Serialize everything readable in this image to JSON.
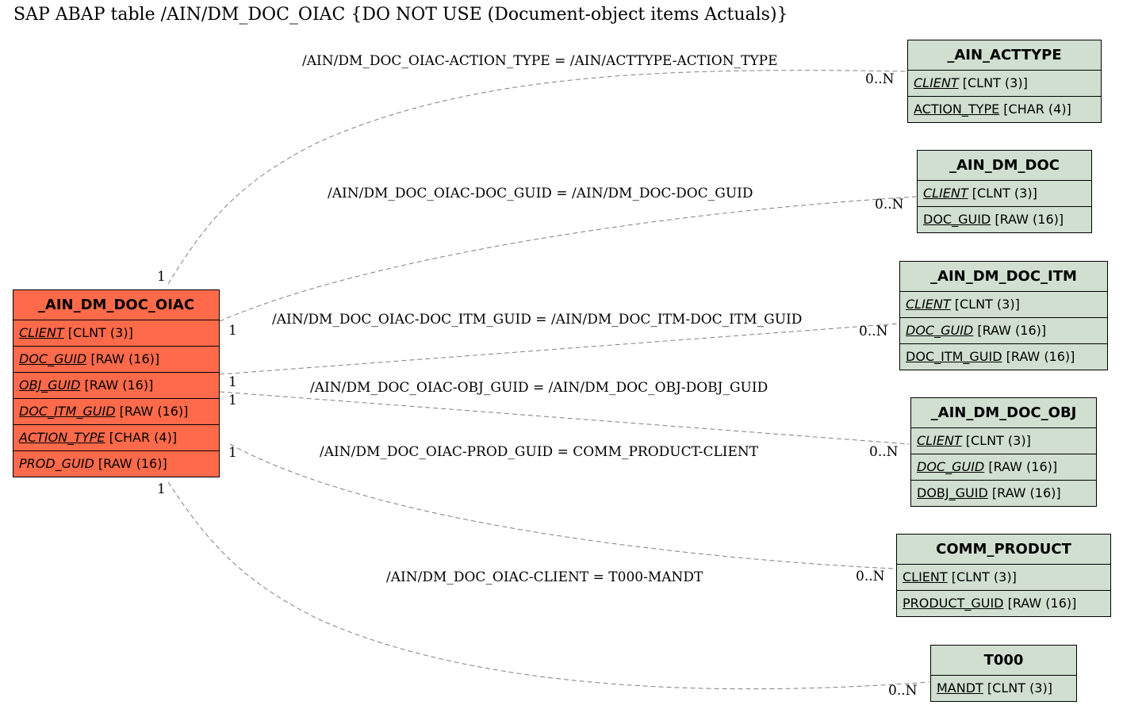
{
  "title": "SAP ABAP table /AIN/DM_DOC_OIAC {DO NOT USE (Document-object items Actuals)}",
  "main_table": {
    "name": "_AIN_DM_DOC_OIAC",
    "color": "#ff6a4a",
    "fields": [
      {
        "name": "CLIENT",
        "type": "[CLNT (3)]",
        "key": true
      },
      {
        "name": "DOC_GUID",
        "type": "[RAW (16)]",
        "key": true
      },
      {
        "name": "OBJ_GUID",
        "type": "[RAW (16)]",
        "key": true
      },
      {
        "name": "DOC_ITM_GUID",
        "type": "[RAW (16)]",
        "key": true
      },
      {
        "name": "ACTION_TYPE",
        "type": "[CHAR (4)]",
        "key": true
      },
      {
        "name": "PROD_GUID",
        "type": "[RAW (16)]",
        "key": false
      }
    ]
  },
  "ref_tables": [
    {
      "name": "_AIN_ACTTYPE",
      "fields": [
        {
          "name": "CLIENT",
          "type": "[CLNT (3)]",
          "italic": true
        },
        {
          "name": "ACTION_TYPE",
          "type": "[CHAR (4)]",
          "italic": false
        }
      ]
    },
    {
      "name": "_AIN_DM_DOC",
      "fields": [
        {
          "name": "CLIENT",
          "type": "[CLNT (3)]",
          "italic": true
        },
        {
          "name": "DOC_GUID",
          "type": "[RAW (16)]",
          "italic": false
        }
      ]
    },
    {
      "name": "_AIN_DM_DOC_ITM",
      "fields": [
        {
          "name": "CLIENT",
          "type": "[CLNT (3)]",
          "italic": true
        },
        {
          "name": "DOC_GUID",
          "type": "[RAW (16)]",
          "italic": true
        },
        {
          "name": "DOC_ITM_GUID",
          "type": "[RAW (16)]",
          "italic": false
        }
      ]
    },
    {
      "name": "_AIN_DM_DOC_OBJ",
      "fields": [
        {
          "name": "CLIENT",
          "type": "[CLNT (3)]",
          "italic": true
        },
        {
          "name": "DOC_GUID",
          "type": "[RAW (16)]",
          "italic": true
        },
        {
          "name": "DOBJ_GUID",
          "type": "[RAW (16)]",
          "italic": false
        }
      ]
    },
    {
      "name": "COMM_PRODUCT",
      "fields": [
        {
          "name": "CLIENT",
          "type": "[CLNT (3)]",
          "italic": false
        },
        {
          "name": "PRODUCT_GUID",
          "type": "[RAW (16)]",
          "italic": false
        }
      ]
    },
    {
      "name": "T000",
      "fields": [
        {
          "name": "MANDT",
          "type": "[CLNT (3)]",
          "italic": false
        }
      ]
    }
  ],
  "ref_color": "#d0dfd0",
  "relations": [
    {
      "label": "/AIN/DM_DOC_OIAC-ACTION_TYPE = /AIN/ACTTYPE-ACTION_TYPE",
      "from_card": "1",
      "to_card": "0..N"
    },
    {
      "label": "/AIN/DM_DOC_OIAC-DOC_GUID = /AIN/DM_DOC-DOC_GUID",
      "from_card": "1",
      "to_card": "0..N"
    },
    {
      "label": "/AIN/DM_DOC_OIAC-DOC_ITM_GUID = /AIN/DM_DOC_ITM-DOC_ITM_GUID",
      "from_card": "1",
      "to_card": "0..N"
    },
    {
      "label": "/AIN/DM_DOC_OIAC-OBJ_GUID = /AIN/DM_DOC_OBJ-DOBJ_GUID",
      "from_card": "1",
      "to_card": "0..N"
    },
    {
      "label": "/AIN/DM_DOC_OIAC-PROD_GUID = COMM_PRODUCT-CLIENT",
      "from_card": "1",
      "to_card": "0..N"
    },
    {
      "label": "/AIN/DM_DOC_OIAC-CLIENT = T000-MANDT",
      "from_card": "1",
      "to_card": "0..N"
    }
  ]
}
